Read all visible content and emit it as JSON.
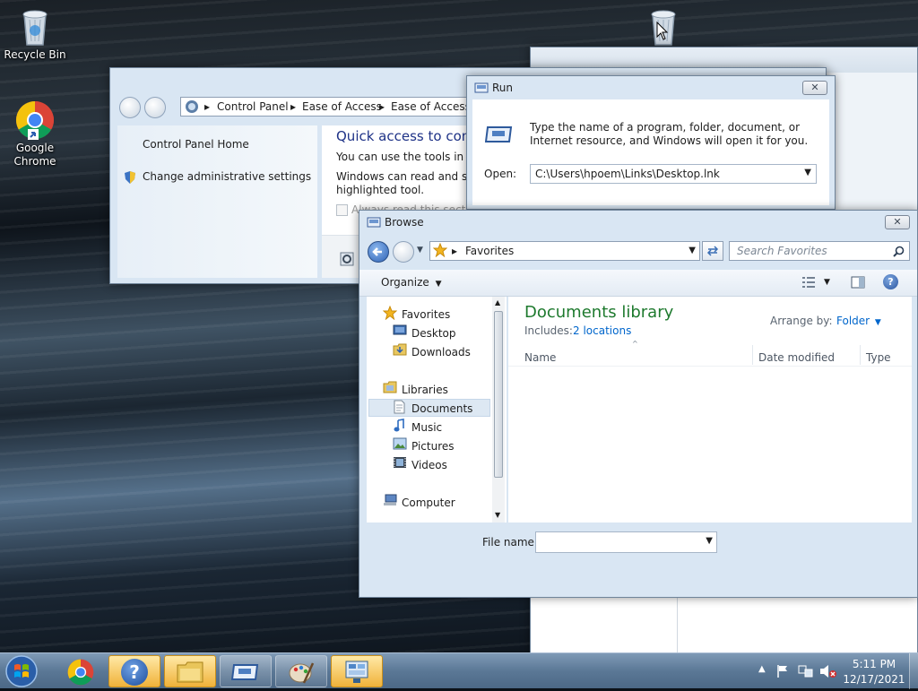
{
  "desktop": {
    "icons": [
      {
        "label": "Recycle Bin"
      },
      {
        "label": "Google Chrome"
      }
    ]
  },
  "control_panel": {
    "breadcrumb": [
      "Control Panel",
      "Ease of Access",
      "Ease of Access C"
    ],
    "sidebar": {
      "home_link": "Control Panel Home",
      "admin_link": "Change administrative settings"
    },
    "main": {
      "heading": "Quick access to comm",
      "line1": "You can use the tools in this",
      "line2": "Windows can read and scan",
      "line3": "highlighted tool.",
      "checkbox_label": "Always read this section"
    }
  },
  "run_dialog": {
    "title": "Run",
    "description": "Type the name of a program, folder, document, or Internet resource, and Windows will open it for you.",
    "open_label": "Open:",
    "open_value": "C:\\Users\\hpoem\\Links\\Desktop.lnk",
    "close_symbol": "✕"
  },
  "browse_dialog": {
    "title": "Browse",
    "address": "Favorites",
    "search_placeholder": "Search Favorites",
    "organize_label": "Organize",
    "help_symbol": "?",
    "nav": {
      "favorites_header": "Favorites",
      "favorites": [
        "Desktop",
        "Downloads"
      ],
      "libraries_header": "Libraries",
      "libraries": [
        "Documents",
        "Music",
        "Pictures",
        "Videos"
      ],
      "computer": "Computer"
    },
    "library": {
      "title": "Documents library",
      "includes_label": "Includes:",
      "includes_link": "2 locations",
      "arrange_by_label": "Arrange by:",
      "arrange_by_value": "Folder"
    },
    "columns": [
      "Name",
      "Date modified",
      "Type"
    ],
    "filename_label": "File name:",
    "filename_value": "",
    "close_symbol": "✕"
  },
  "taskbar": {
    "clock_time": "5:11 PM",
    "clock_date": "12/17/2021",
    "help_symbol": "?"
  },
  "colors": {
    "library_title": "#1e7a2e",
    "link_blue": "#0066cc",
    "selected_nav": "#dde8f3"
  }
}
